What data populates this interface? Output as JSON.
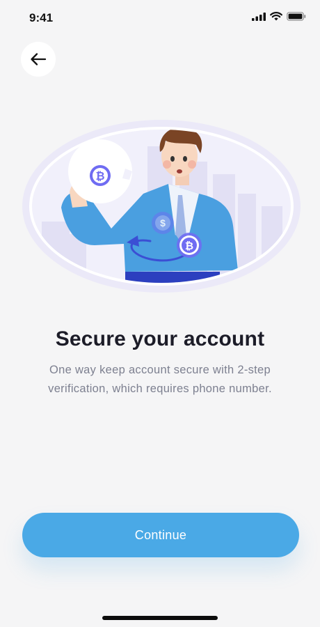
{
  "status_bar": {
    "time": "9:41",
    "icons": [
      "cellular-signal-icon",
      "wifi-icon",
      "battery-icon"
    ]
  },
  "nav": {
    "back_icon": "arrow-left-icon"
  },
  "illustration": {
    "icons": [
      "bitcoin-coin-icon",
      "dollar-coin-icon",
      "swap-arrow-icon"
    ]
  },
  "content": {
    "title": "Secure your account",
    "subtitle": "One way keep account secure with 2-step verification, which requires phone number."
  },
  "actions": {
    "continue_label": "Continue"
  },
  "colors": {
    "background": "#f5f5f6",
    "primary": "#4aa9e6",
    "title": "#1c1c28",
    "subtitle": "#7d8090",
    "accent_purple": "#6f6cf2"
  }
}
